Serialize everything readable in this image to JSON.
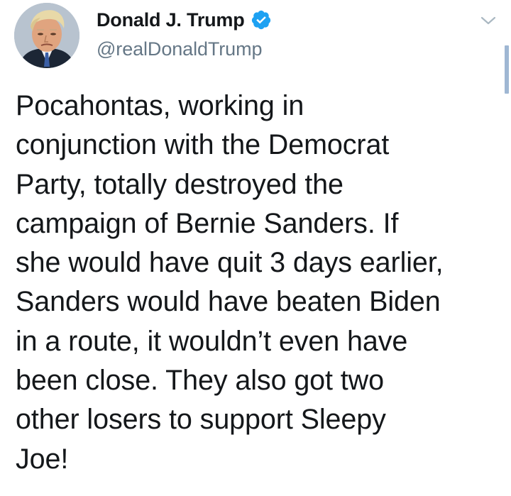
{
  "author": {
    "display_name": "Donald J. Trump",
    "handle": "@realDonaldTrump",
    "verified": true,
    "avatar_icon": "profile-photo"
  },
  "tweet": {
    "lines": [
      "Pocahontas, working in",
      "conjunction with the Democrat",
      "Party, totally destroyed the",
      "campaign of Bernie Sanders. If",
      "she would have quit 3 days earlier,",
      "Sanders would have beaten Biden",
      "in a route, it wouldn’t even have",
      "been close. They also got two",
      "other losers to support Sleepy",
      "Joe!"
    ]
  },
  "icons": {
    "verified": "verified-badge-icon",
    "menu": "chevron-down-icon"
  },
  "colors": {
    "text": "#14171a",
    "secondary_text": "#657786",
    "verified_blue": "#1da1f2",
    "caret": "#aab8c2",
    "scroll_indicator": "#9fb7d3"
  }
}
